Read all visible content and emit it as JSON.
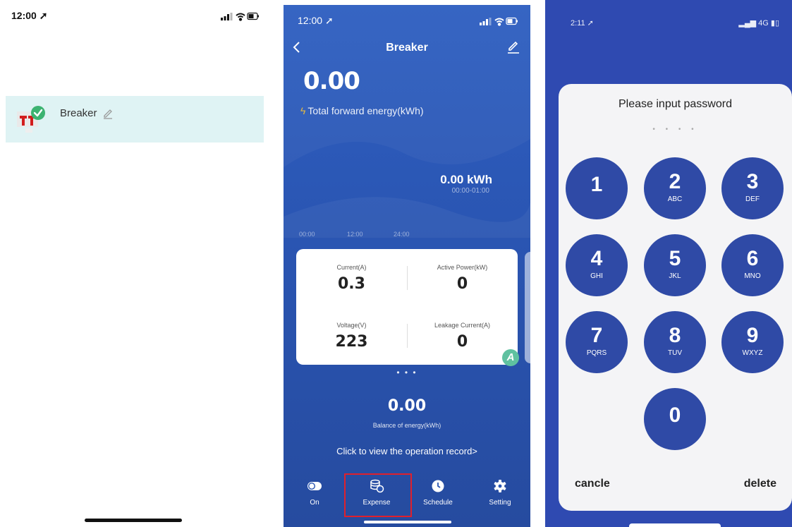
{
  "panel1": {
    "time": "12:00",
    "device_name": "Breaker",
    "colors": {
      "row_bg": "#dff3f4",
      "check": "#3cb371",
      "logo": "#d21c1c"
    }
  },
  "panel2": {
    "time": "12:00",
    "title": "Breaker",
    "total_forward_energy_value": "0.00",
    "total_forward_energy_label": "Total forward energy(kWh)",
    "hour_energy_value": "0.00 kWh",
    "hour_energy_range": "00:00-01:00",
    "axis_labels": [
      "00:00",
      "12:00",
      "24:00"
    ],
    "stats": {
      "current_label": "Current(A)",
      "current_value": "0.3",
      "active_power_label": "Active Power(kW)",
      "active_power_value": "0",
      "voltage_label": "Voltage(V)",
      "voltage_value": "223",
      "leakage_label": "Leakage Current(A)",
      "leakage_value": "0",
      "badge": "A"
    },
    "pager_dots": "• • •",
    "balance_value": "0.00",
    "balance_label": "Balance of energy(kWh)",
    "record_link": "Click to view the operation record>",
    "tabs": [
      {
        "label": "On",
        "icon": "toggle-icon"
      },
      {
        "label": "Expense",
        "icon": "coins-icon"
      },
      {
        "label": "Schedule",
        "icon": "clock-icon"
      },
      {
        "label": "Setting",
        "icon": "gear-icon"
      }
    ],
    "highlighted_tab": "Expense",
    "colors": {
      "background": "#2c57b8",
      "bolt": "#f8c334",
      "highlight_border": "#e0202c",
      "badge": "#5fc1a0"
    }
  },
  "panel3": {
    "time": "2:11",
    "network": "4G",
    "prompt": "Please input password",
    "pin_dots": "• • • •",
    "keys": [
      {
        "digit": "1",
        "letters": ""
      },
      {
        "digit": "2",
        "letters": "ABC"
      },
      {
        "digit": "3",
        "letters": "DEF"
      },
      {
        "digit": "4",
        "letters": "GHI"
      },
      {
        "digit": "5",
        "letters": "JKL"
      },
      {
        "digit": "6",
        "letters": "MNO"
      },
      {
        "digit": "7",
        "letters": "PQRS"
      },
      {
        "digit": "8",
        "letters": "TUV"
      },
      {
        "digit": "9",
        "letters": "WXYZ"
      },
      {
        "digit": "0",
        "letters": ""
      }
    ],
    "cancel_label": "cancle",
    "delete_label": "delete",
    "colors": {
      "background": "#2f4ab1",
      "key": "#2f4aa6",
      "sheet": "#f4f4f6"
    }
  }
}
